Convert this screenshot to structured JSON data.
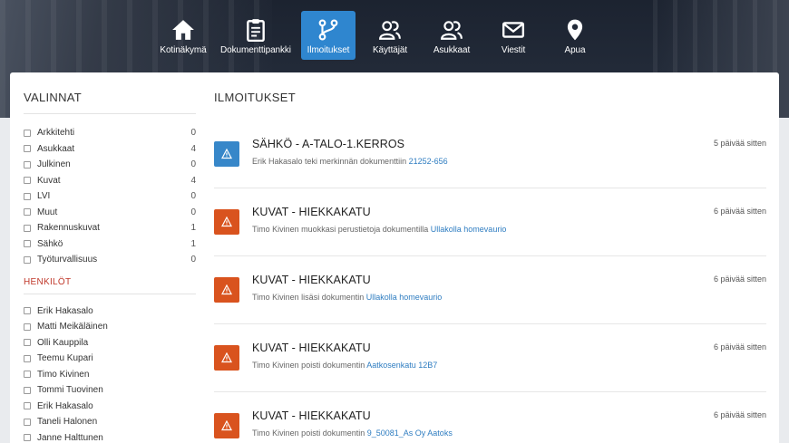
{
  "nav": [
    {
      "label": "Kotinäkymä",
      "icon": "home-icon"
    },
    {
      "label": "Dokumenttipankki",
      "icon": "clipboard-icon"
    },
    {
      "label": "Ilmoitukset",
      "icon": "branch-icon",
      "active": true
    },
    {
      "label": "Käyttäjät",
      "icon": "users-icon"
    },
    {
      "label": "Asukkaat",
      "icon": "users-icon"
    },
    {
      "label": "Viestit",
      "icon": "mail-icon"
    },
    {
      "label": "Apua",
      "icon": "map-pin-icon"
    }
  ],
  "sidebar": {
    "title": "VALINNAT",
    "categories": [
      {
        "label": "Arkkitehti",
        "count": "0"
      },
      {
        "label": "Asukkaat",
        "count": "4"
      },
      {
        "label": "Julkinen",
        "count": "0"
      },
      {
        "label": "Kuvat",
        "count": "4"
      },
      {
        "label": "LVI",
        "count": "0"
      },
      {
        "label": "Muut",
        "count": "0"
      },
      {
        "label": "Rakennuskuvat",
        "count": "1"
      },
      {
        "label": "Sähkö",
        "count": "1"
      },
      {
        "label": "Työturvallisuus",
        "count": "0"
      }
    ],
    "people_title": "HENKILÖT",
    "people": [
      "Erik Hakasalo",
      "Matti Meikäläinen",
      "Olli Kauppila",
      "Teemu Kupari",
      "Timo Kivinen",
      "Tommi Tuovinen",
      "Erik Hakasalo",
      "Taneli Halonen",
      "Janne Halttunen"
    ]
  },
  "main": {
    "title": "ILMOITUKSET",
    "notifications": [
      {
        "title": "SÄHKÖ - A-TALO-1.KERROS",
        "text": "Erik Hakasalo teki merkinnän dokumenttiin",
        "link": "21252-656",
        "time": "5 päivää sitten",
        "color": "#3787c9"
      },
      {
        "title": "KUVAT - HIEKKAKATU",
        "text": "Timo Kivinen muokkasi perustietoja dokumentilla",
        "link": "Ullakolla homevaurio",
        "time": "6 päivää sitten",
        "color": "#d9531e"
      },
      {
        "title": "KUVAT - HIEKKAKATU",
        "text": "Timo Kivinen lisäsi dokumentin",
        "link": "Ullakolla homevaurio",
        "time": "6 päivää sitten",
        "color": "#d9531e"
      },
      {
        "title": "KUVAT - HIEKKAKATU",
        "text": "Timo Kivinen poisti dokumentin",
        "link": "Aatkosenkatu 12B7",
        "time": "6 päivää sitten",
        "color": "#d9531e"
      },
      {
        "title": "KUVAT - HIEKKAKATU",
        "text": "Timo Kivinen poisti dokumentin",
        "link": "9_50081_As Oy Aatoks",
        "time": "6 päivää sitten",
        "color": "#d9531e"
      }
    ]
  }
}
